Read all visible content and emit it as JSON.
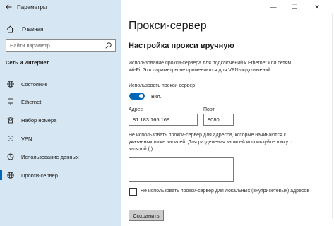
{
  "window": {
    "title": "Параметры",
    "controls": {
      "minimize_icon": "—",
      "maximize_icon": "☐",
      "close_icon": "✕"
    }
  },
  "sidebar": {
    "home_label": "Главная",
    "search_placeholder": "Найти параметр",
    "section_title": "Сеть и Интернет",
    "items": [
      {
        "label": "Состояние",
        "icon": "globe-icon"
      },
      {
        "label": "Ethernet",
        "icon": "ethernet-icon"
      },
      {
        "label": "Набор номера",
        "icon": "dialup-icon"
      },
      {
        "label": "VPN",
        "icon": "vpn-icon"
      },
      {
        "label": "Использование данных",
        "icon": "data-usage-icon"
      },
      {
        "label": "Прокси-сервер",
        "icon": "globe-icon",
        "active": true
      }
    ]
  },
  "main": {
    "title": "Прокси-сервер",
    "subheading": "Настройка прокси вручную",
    "description": "Использование прокси-сервера для подключений к Ethernet или сетям Wi-Fi. Эти параметры не применяются для VPN-подключений.",
    "use_proxy_label": "Использовать прокси-сервер",
    "toggle_state": "Вкл.",
    "address_label": "Адрес",
    "address_value": "81.183.165.169",
    "port_label": "Порт",
    "port_value": "8080",
    "exceptions_text": "Не использовать прокси-сервер для адресов, которые начинаются с указанных ниже записей. Для разделения записей используйте точку с запятой (;).",
    "exceptions_value": "",
    "local_checkbox_label": "Не использовать прокси-сервер для локальных (внутрисетевых) адресов",
    "save_label": "Сохранить"
  },
  "colors": {
    "sidebar_bg": "#d6e6f2",
    "accent": "#0067b8",
    "button_bg": "#cccccc"
  }
}
